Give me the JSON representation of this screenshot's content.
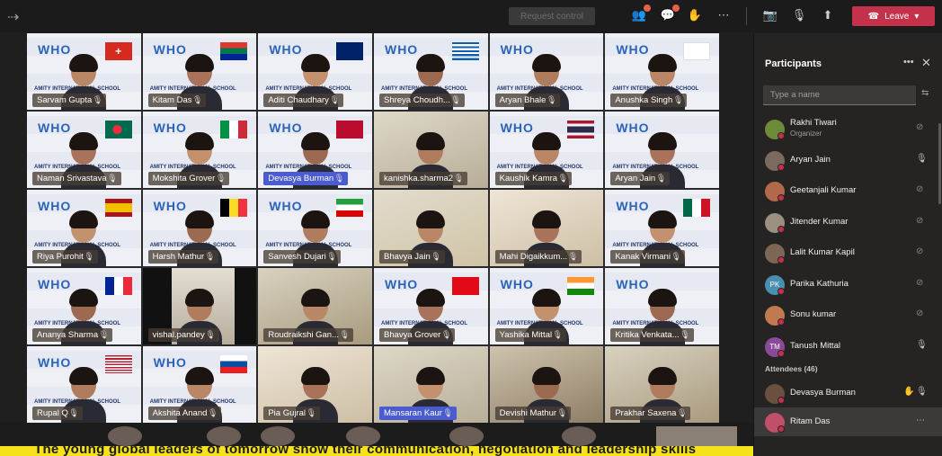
{
  "topbar": {
    "request_control": "Request control",
    "leave_label": "Leave",
    "colors": {
      "leave": "#c4314b",
      "bar": "#1b1b1b"
    }
  },
  "grid": {
    "tiles": [
      {
        "name": "Sarvam Gupta",
        "bg": "banner",
        "flag": "switzerland"
      },
      {
        "name": "Kitam Das",
        "bg": "banner",
        "flag": "south-africa"
      },
      {
        "name": "Aditi Chaudhary",
        "bg": "banner",
        "flag": "australia"
      },
      {
        "name": "Shreya Choudh...",
        "bg": "banner",
        "flag": "greece"
      },
      {
        "name": "Aryan Bhale",
        "bg": "banner",
        "flag": "none"
      },
      {
        "name": "Anushka Singh",
        "bg": "banner",
        "flag": "georgia"
      },
      {
        "name": "Naman Srivastava",
        "bg": "banner",
        "flag": "bangladesh"
      },
      {
        "name": "Mokshita Grover",
        "bg": "banner",
        "flag": "italy"
      },
      {
        "name": "Devasya Burman",
        "bg": "banner",
        "flag": "norway"
      },
      {
        "name": "kanishka.sharma2",
        "bg": "room1",
        "flag": "none"
      },
      {
        "name": "Kaushik Kamra",
        "bg": "banner",
        "flag": "thailand"
      },
      {
        "name": "Aryan Jain",
        "bg": "banner",
        "flag": "none"
      },
      {
        "name": "Riya Purohit",
        "bg": "banner",
        "flag": "spain"
      },
      {
        "name": "Harsh Mathur",
        "bg": "banner",
        "flag": "belgium"
      },
      {
        "name": "Sanvesh Dujari",
        "bg": "banner",
        "flag": "iran"
      },
      {
        "name": "Bhavya Jain",
        "bg": "room2",
        "flag": "none"
      },
      {
        "name": "Mahi Digaikkum...",
        "bg": "room3",
        "flag": "none"
      },
      {
        "name": "Kanak Virmani",
        "bg": "banner",
        "flag": "mexico"
      },
      {
        "name": "Ananya Sharma",
        "bg": "banner",
        "flag": "france"
      },
      {
        "name": "vishal.pandey",
        "bg": "dark",
        "flag": "none"
      },
      {
        "name": "Roudraikshi Gan...",
        "bg": "room4",
        "flag": "none"
      },
      {
        "name": "Bhavya Grover",
        "bg": "banner",
        "flag": "turkey"
      },
      {
        "name": "Yashika Mittal",
        "bg": "banner",
        "flag": "india"
      },
      {
        "name": "Kritika Venkata...",
        "bg": "banner",
        "flag": "none"
      },
      {
        "name": "Rupal Q",
        "bg": "banner",
        "flag": "usa"
      },
      {
        "name": "Akshita Anand",
        "bg": "banner",
        "flag": "slovakia"
      },
      {
        "name": "Pia Gujral",
        "bg": "room3",
        "flag": "none"
      },
      {
        "name": "Mansaran Kaur",
        "bg": "room1",
        "flag": "none"
      },
      {
        "name": "Devishi Mathur",
        "bg": "room5",
        "flag": "none"
      },
      {
        "name": "Prakhar Saxena",
        "bg": "room4",
        "flag": "none"
      }
    ],
    "who_text": "WHO",
    "school_text": "AMITY INTERNATIONAL SCHOOL"
  },
  "panel": {
    "title": "Participants",
    "search_placeholder": "Type a name",
    "presenters": [
      {
        "name": "Rakhi Tiwari",
        "role": "Organizer",
        "mic": "off",
        "avatar_color": "#6b8a3a",
        "initials": ""
      },
      {
        "name": "Aryan Jain",
        "role": "",
        "mic": "on",
        "avatar_color": "#7a6a60",
        "initials": ""
      },
      {
        "name": "Geetanjali Kumar",
        "role": "",
        "mic": "off",
        "avatar_color": "#b06a4a",
        "initials": ""
      },
      {
        "name": "Jitender Kumar",
        "role": "",
        "mic": "off",
        "avatar_color": "#9a8f80",
        "initials": ""
      },
      {
        "name": "Lalit Kumar Kapil",
        "role": "",
        "mic": "off",
        "avatar_color": "#7d6655",
        "initials": ""
      },
      {
        "name": "Parika Kathuria",
        "role": "",
        "mic": "off",
        "avatar_color": "#4a8fb0",
        "initials": "PK"
      },
      {
        "name": "Sonu kumar",
        "role": "",
        "mic": "off",
        "avatar_color": "#c07a50",
        "initials": ""
      },
      {
        "name": "Tanush Mittal",
        "role": "",
        "mic": "on",
        "avatar_color": "#8a4a9a",
        "initials": "TM"
      }
    ],
    "attendees_label": "Attendees (46)",
    "attendees": [
      {
        "name": "Devasya Burman",
        "hand": true,
        "mic": "on",
        "avatar_color": "#6a5040"
      },
      {
        "name": "Ritam Das",
        "hand": false,
        "mic": "",
        "avatar_color": "#c0506a"
      }
    ]
  },
  "caption": {
    "text": "The young global leaders of tomorrow show their communication, negotiation and leadership skills"
  }
}
